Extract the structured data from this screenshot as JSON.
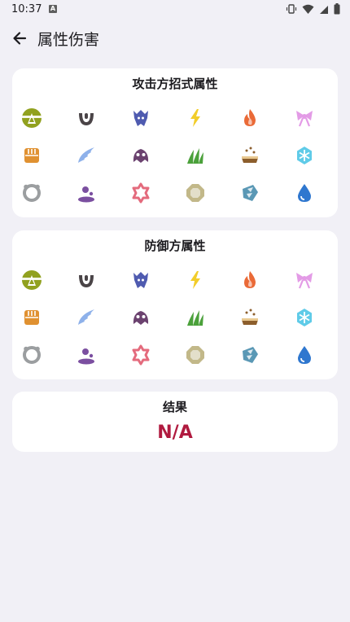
{
  "status_bar": {
    "time": "10:37"
  },
  "app_bar": {
    "title": "属性伤害"
  },
  "attacker_card": {
    "title": "攻击方招式属性"
  },
  "defender_card": {
    "title": "防御方属性"
  },
  "result_card": {
    "title": "结果",
    "value": "N/A",
    "value_color": "#b01a3f"
  },
  "types": [
    {
      "name": "bug",
      "color": "#91a11f"
    },
    {
      "name": "dark",
      "color": "#4a4447"
    },
    {
      "name": "dragon",
      "color": "#4f5bb0"
    },
    {
      "name": "electric",
      "color": "#f2cd2a"
    },
    {
      "name": "fire",
      "color": "#ea6a37"
    },
    {
      "name": "fairy",
      "color": "#e39be6"
    },
    {
      "name": "fighting",
      "color": "#e09131"
    },
    {
      "name": "flying",
      "color": "#8eb1ea"
    },
    {
      "name": "ghost",
      "color": "#6b426f"
    },
    {
      "name": "grass",
      "color": "#4ba13b"
    },
    {
      "name": "ground",
      "color": "#8c5e2c"
    },
    {
      "name": "ice",
      "color": "#5fcbe8"
    },
    {
      "name": "normal",
      "color": "#9b9ea0"
    },
    {
      "name": "poison",
      "color": "#7b4fa0"
    },
    {
      "name": "psychic",
      "color": "#e46b7d"
    },
    {
      "name": "rock",
      "color": "#c2b889"
    },
    {
      "name": "steel",
      "color": "#5a98b5"
    },
    {
      "name": "water",
      "color": "#2f77cf"
    }
  ]
}
